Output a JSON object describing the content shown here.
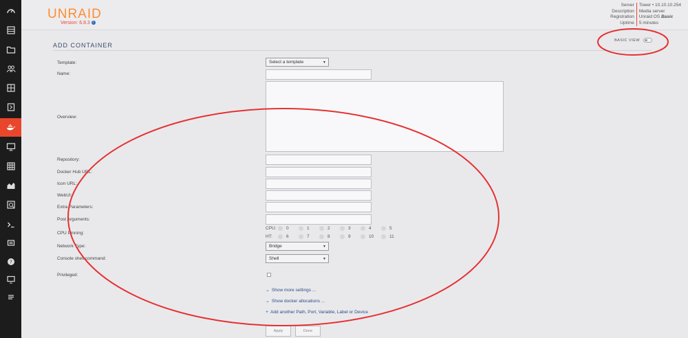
{
  "brand": {
    "name": "UNRAID",
    "version": "Version: 6.8.3",
    "info_glyph": "i"
  },
  "server_info": [
    {
      "key": "Server",
      "value": "Tower • 10.10.10.254"
    },
    {
      "key": "Description",
      "value": "Media server"
    },
    {
      "key": "Registration",
      "value_prefix": "Unraid OS ",
      "value_emph": "Basic"
    },
    {
      "key": "Uptime",
      "value": "5 minutes"
    }
  ],
  "sidebar": {
    "items": [
      {
        "icon": "dashboard-icon"
      },
      {
        "icon": "main-icon"
      },
      {
        "icon": "shares-icon"
      },
      {
        "icon": "users-icon"
      },
      {
        "icon": "settings-icon"
      },
      {
        "icon": "plugins-icon"
      },
      {
        "icon": "docker-icon",
        "active": true
      },
      {
        "icon": "vms-icon"
      },
      {
        "icon": "apps-icon"
      },
      {
        "icon": "stats-icon"
      },
      {
        "icon": "tools-icon"
      },
      {
        "icon": "terminal-icon"
      },
      {
        "icon": "feedback-icon"
      },
      {
        "icon": "help-icon"
      },
      {
        "icon": "info-icon"
      },
      {
        "icon": "log-icon"
      }
    ]
  },
  "page": {
    "title": "ADD CONTAINER",
    "basic_view_label": "BASIC VIEW"
  },
  "form": {
    "template_label": "Template:",
    "template_value": "Select a template",
    "name_label": "Name:",
    "overview_label": "Overview:",
    "repository_label": "Repository:",
    "dockerhub_label": "Docker Hub URL:",
    "icon_label": "Icon URL:",
    "webui_label": "WebUI:",
    "extra_label": "Extra Parameters:",
    "post_label": "Post Arguments:",
    "cpu_label": "CPU Pinning:",
    "network_label": "Network Type:",
    "network_value": "Bridge",
    "console_label": "Console shell command:",
    "console_value": "Shell",
    "privileged_label": "Privileged:"
  },
  "cpu_pinning": {
    "cpu_label": "CPU:",
    "ht_label": "HT:",
    "cpu": [
      "0",
      "1",
      "2",
      "3",
      "4",
      "5"
    ],
    "ht": [
      "6",
      "7",
      "8",
      "9",
      "10",
      "11"
    ]
  },
  "links": {
    "more_settings": "Show more settings ...",
    "docker_alloc": "Show docker allocations ...",
    "add_another": "Add another Path, Port, Variable, Label or Device"
  },
  "buttons": {
    "apply": "Apply",
    "done": "Done"
  },
  "colors": {
    "accent": "#e8472b",
    "brand": "#ff8c2f",
    "annotation": "#e63030"
  }
}
